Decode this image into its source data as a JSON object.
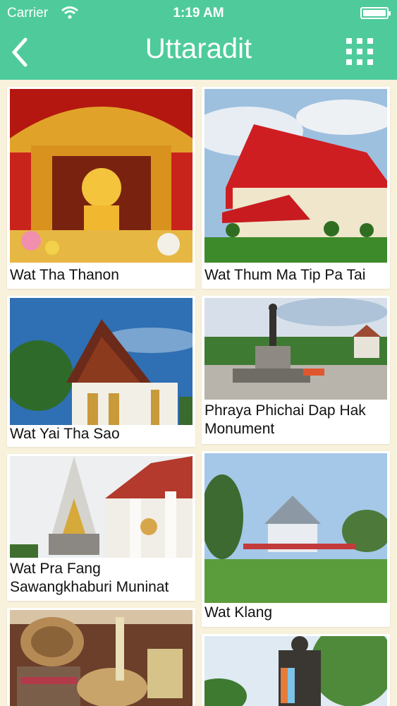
{
  "status_bar": {
    "carrier": "Carrier",
    "time": "1:19 AM"
  },
  "nav": {
    "title": "Uttaradit",
    "back_icon": "chevron-left-icon",
    "menu_icon": "grid-icon"
  },
  "colors": {
    "header": "#4fcb9b",
    "background": "#f8f1dc"
  },
  "places": [
    {
      "name": "Wat Tha Thanon"
    },
    {
      "name": "Wat Thum Ma Tip Pa Tai"
    },
    {
      "name": "Wat Yai Tha Sao"
    },
    {
      "name": "Phraya Phichai Dap Hak Monument"
    },
    {
      "name": "Wat Pra Fang Sawangkhaburi Muninat"
    },
    {
      "name": "Wat Klang"
    },
    {
      "name": ""
    },
    {
      "name": ""
    }
  ]
}
